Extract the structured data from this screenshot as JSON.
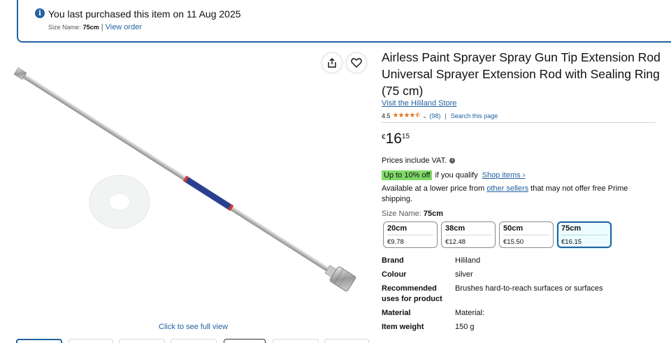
{
  "banner": {
    "title": "You last purchased this item on 11 Aug 2025",
    "size_label": "Size Name:",
    "size_value": "75cm",
    "separator": "|",
    "view_order": "View order",
    "info_icon": "info-icon"
  },
  "image": {
    "full_view_label": "Click to see full view",
    "share_icon": "share-icon",
    "heart_icon": "heart-icon"
  },
  "product": {
    "title": "Airless Paint Sprayer Spray Gun Tip Extension Rod Universal Sprayer Extension Rod with Sealing Ring (75 cm)",
    "store_link": "Visit the Hililand Store",
    "rating": "4.5",
    "stars": "★★★★⯪",
    "stars_value": 4.5,
    "rating_count": "(98)",
    "rating_separator": "|",
    "search_page": "Search this page"
  },
  "price": {
    "currency": "€",
    "whole": "16",
    "fraction": "15",
    "vat_note": "Prices include VAT."
  },
  "discount": {
    "badge": "Up to 10% off",
    "qualify_text": "if you qualify",
    "shop_items": "Shop items ›",
    "badge_color": "#7fda69"
  },
  "lower_price": {
    "prefix": "Available at a lower price from ",
    "link": "other sellers",
    "suffix": " that may not offer free Prime shipping."
  },
  "size_selector": {
    "label": "Size Name:",
    "selected": "75cm",
    "options": [
      {
        "name": "20cm",
        "price": "€9.78"
      },
      {
        "name": "38cm",
        "price": "€12.48"
      },
      {
        "name": "50cm",
        "price": "€15.50"
      },
      {
        "name": "75cm",
        "price": "€16.15"
      }
    ]
  },
  "specs": [
    {
      "key": "Brand",
      "value": "Hililand"
    },
    {
      "key": "Colour",
      "value": "silver"
    },
    {
      "key": "Recommended uses for product",
      "value": "Brushes hard-to-reach surfaces or surfaces"
    },
    {
      "key": "Material",
      "value": "Material:"
    },
    {
      "key": "Item weight",
      "value": "150 g"
    }
  ],
  "colors": {
    "link": "#2162a1",
    "star": "#de7921",
    "selected_border": "#2162a1"
  }
}
